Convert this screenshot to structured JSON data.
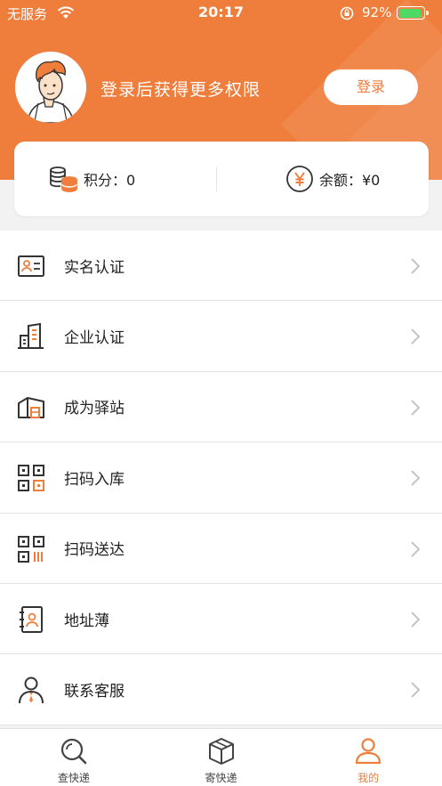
{
  "status_bar": {
    "carrier": "无服务",
    "time": "20:17",
    "battery_percent": "92%",
    "battery_level": 0.92,
    "battery_color": "#4cd964"
  },
  "header": {
    "background_color": "#ef7d3c",
    "login_prompt": "登录后获得更多权限",
    "login_button": "登录"
  },
  "summary": {
    "points_label": "积分：0",
    "balance_label": "余额：¥0",
    "points_icon": "coins-icon",
    "balance_icon": "yuan-coin-icon"
  },
  "menu": {
    "items": [
      {
        "label": "实名认证",
        "icon": "id-card-icon"
      },
      {
        "label": "企业认证",
        "icon": "building-icon"
      },
      {
        "label": "成为驿站",
        "icon": "station-icon"
      },
      {
        "label": "扫码入库",
        "icon": "qr-scan-icon"
      },
      {
        "label": "扫码送达",
        "icon": "barcode-scan-icon"
      },
      {
        "label": "地址薄",
        "icon": "address-book-icon"
      },
      {
        "label": "联系客服",
        "icon": "customer-service-icon"
      }
    ]
  },
  "tabbar": {
    "tabs": [
      {
        "label": "查快递",
        "icon": "search-icon",
        "active": false
      },
      {
        "label": "寄快递",
        "icon": "package-icon",
        "active": false
      },
      {
        "label": "我的",
        "icon": "user-icon",
        "active": true
      }
    ],
    "active_color": "#ef7d3c"
  }
}
